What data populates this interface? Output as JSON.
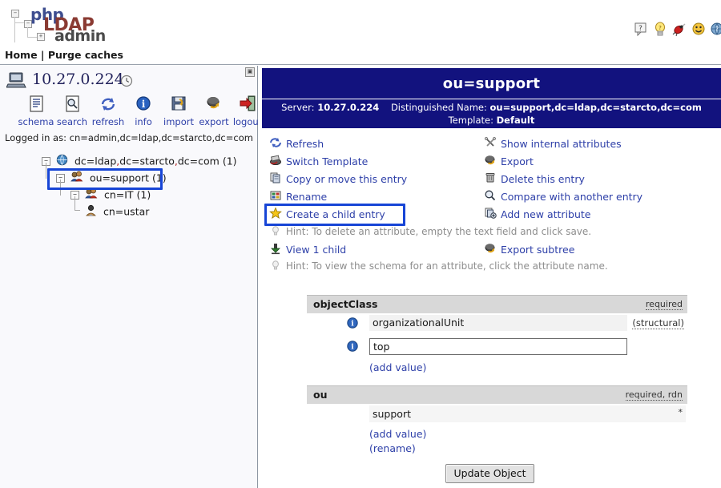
{
  "branding": {
    "logo_php": "php",
    "logo_ldap": "LDAP",
    "logo_admin": "admin"
  },
  "header_icons": [
    {
      "name": "help-icon",
      "glyph": "help"
    },
    {
      "name": "lightbulb-icon",
      "glyph": "bulb"
    },
    {
      "name": "bug-icon",
      "glyph": "bug"
    },
    {
      "name": "smiley-icon",
      "glyph": "smiley"
    },
    {
      "name": "globe-help-icon",
      "glyph": "globe"
    }
  ],
  "breadcrumb": {
    "home": "Home",
    "separator": "|",
    "purge": "Purge caches",
    "full": "Home | Purge caches"
  },
  "sidebar": {
    "collapse_glyph": "▣",
    "server_ip": "10.27.0.224",
    "clock_icon": "clock-icon",
    "toolbar": [
      {
        "label": "schema",
        "icon": "schema-icon"
      },
      {
        "label": "search",
        "icon": "search-icon"
      },
      {
        "label": "refresh",
        "icon": "refresh-icon"
      },
      {
        "label": "info",
        "icon": "info-icon"
      },
      {
        "label": "import",
        "icon": "import-icon"
      },
      {
        "label": "export",
        "icon": "export-icon"
      },
      {
        "label": "logout",
        "icon": "logout-icon"
      }
    ],
    "logged_in_as": "Logged in as: cn=admin,dc=ldap,dc=starcto,dc=com",
    "tree": [
      {
        "label": "dc=ldap,dc=starcto,dc=com (1)",
        "icon": "globe-icon",
        "expander": "−",
        "depth": 0,
        "highlight": false
      },
      {
        "label": "ou=support (1)",
        "icon": "group-icon",
        "expander": "−",
        "depth": 1,
        "highlight": true
      },
      {
        "label": "cn=IT (1)",
        "icon": "group-icon",
        "expander": "−",
        "depth": 2,
        "highlight": false
      },
      {
        "label": "cn=ustar",
        "icon": "user-icon",
        "expander": "",
        "depth": 3,
        "highlight": false
      }
    ]
  },
  "main": {
    "title": "ou=support",
    "server_label": "Server:",
    "server_value": "10.27.0.224",
    "dn_label": "Distinguished Name:",
    "dn_value": "ou=support,dc=ldap,dc=starcto,dc=com",
    "template_label": "Template:",
    "template_value": "Default",
    "actions_left": [
      {
        "label": "Refresh",
        "icon": "refresh-icon",
        "highlight": false
      },
      {
        "label": "Switch Template",
        "icon": "switch-template-icon",
        "highlight": false
      },
      {
        "label": "Copy or move this entry",
        "icon": "copy-icon",
        "highlight": false
      },
      {
        "label": "Rename",
        "icon": "rename-icon",
        "highlight": false
      },
      {
        "label": "Create a child entry",
        "icon": "star-icon",
        "highlight": true
      }
    ],
    "actions_right": [
      {
        "label": "Show internal attributes",
        "icon": "tools-icon"
      },
      {
        "label": "Export",
        "icon": "export-icon"
      },
      {
        "label": "Delete this entry",
        "icon": "trash-icon"
      },
      {
        "label": "Compare with another entry",
        "icon": "compare-icon"
      },
      {
        "label": "Add new attribute",
        "icon": "add-attribute-icon"
      }
    ],
    "hint_delete": "Hint: To delete an attribute, empty the text field and click save.",
    "view_children": "View 1 child",
    "view_children_icon": "download-icon",
    "export_subtree": "Export subtree",
    "export_subtree_icon": "export-icon",
    "hint_schema": "Hint: To view the schema for an attribute, click the attribute name.",
    "attributes": [
      {
        "name": "objectClass",
        "flags": "required",
        "values": [
          {
            "value": "organizationalUnit",
            "editable": false,
            "info": true,
            "note": "(structural)"
          },
          {
            "value": "top",
            "editable": true,
            "info": true,
            "note": ""
          }
        ],
        "links": [
          "(add value)"
        ]
      },
      {
        "name": "ou",
        "flags": "required, rdn",
        "values": [
          {
            "value": "support",
            "editable": false,
            "info": false,
            "note": "*"
          }
        ],
        "links": [
          "(add value)",
          "(rename)"
        ]
      }
    ],
    "update_button": "Update Object"
  },
  "colors": {
    "header_blue": "#12127e",
    "link_blue": "#2d3fa8",
    "highlight_blue": "#1745d6",
    "attr_header_gray": "#d8d8d8",
    "hint_gray": "#8d8d8d",
    "logo_php": "#3d4d8f",
    "logo_ldap": "#8a3a32"
  }
}
